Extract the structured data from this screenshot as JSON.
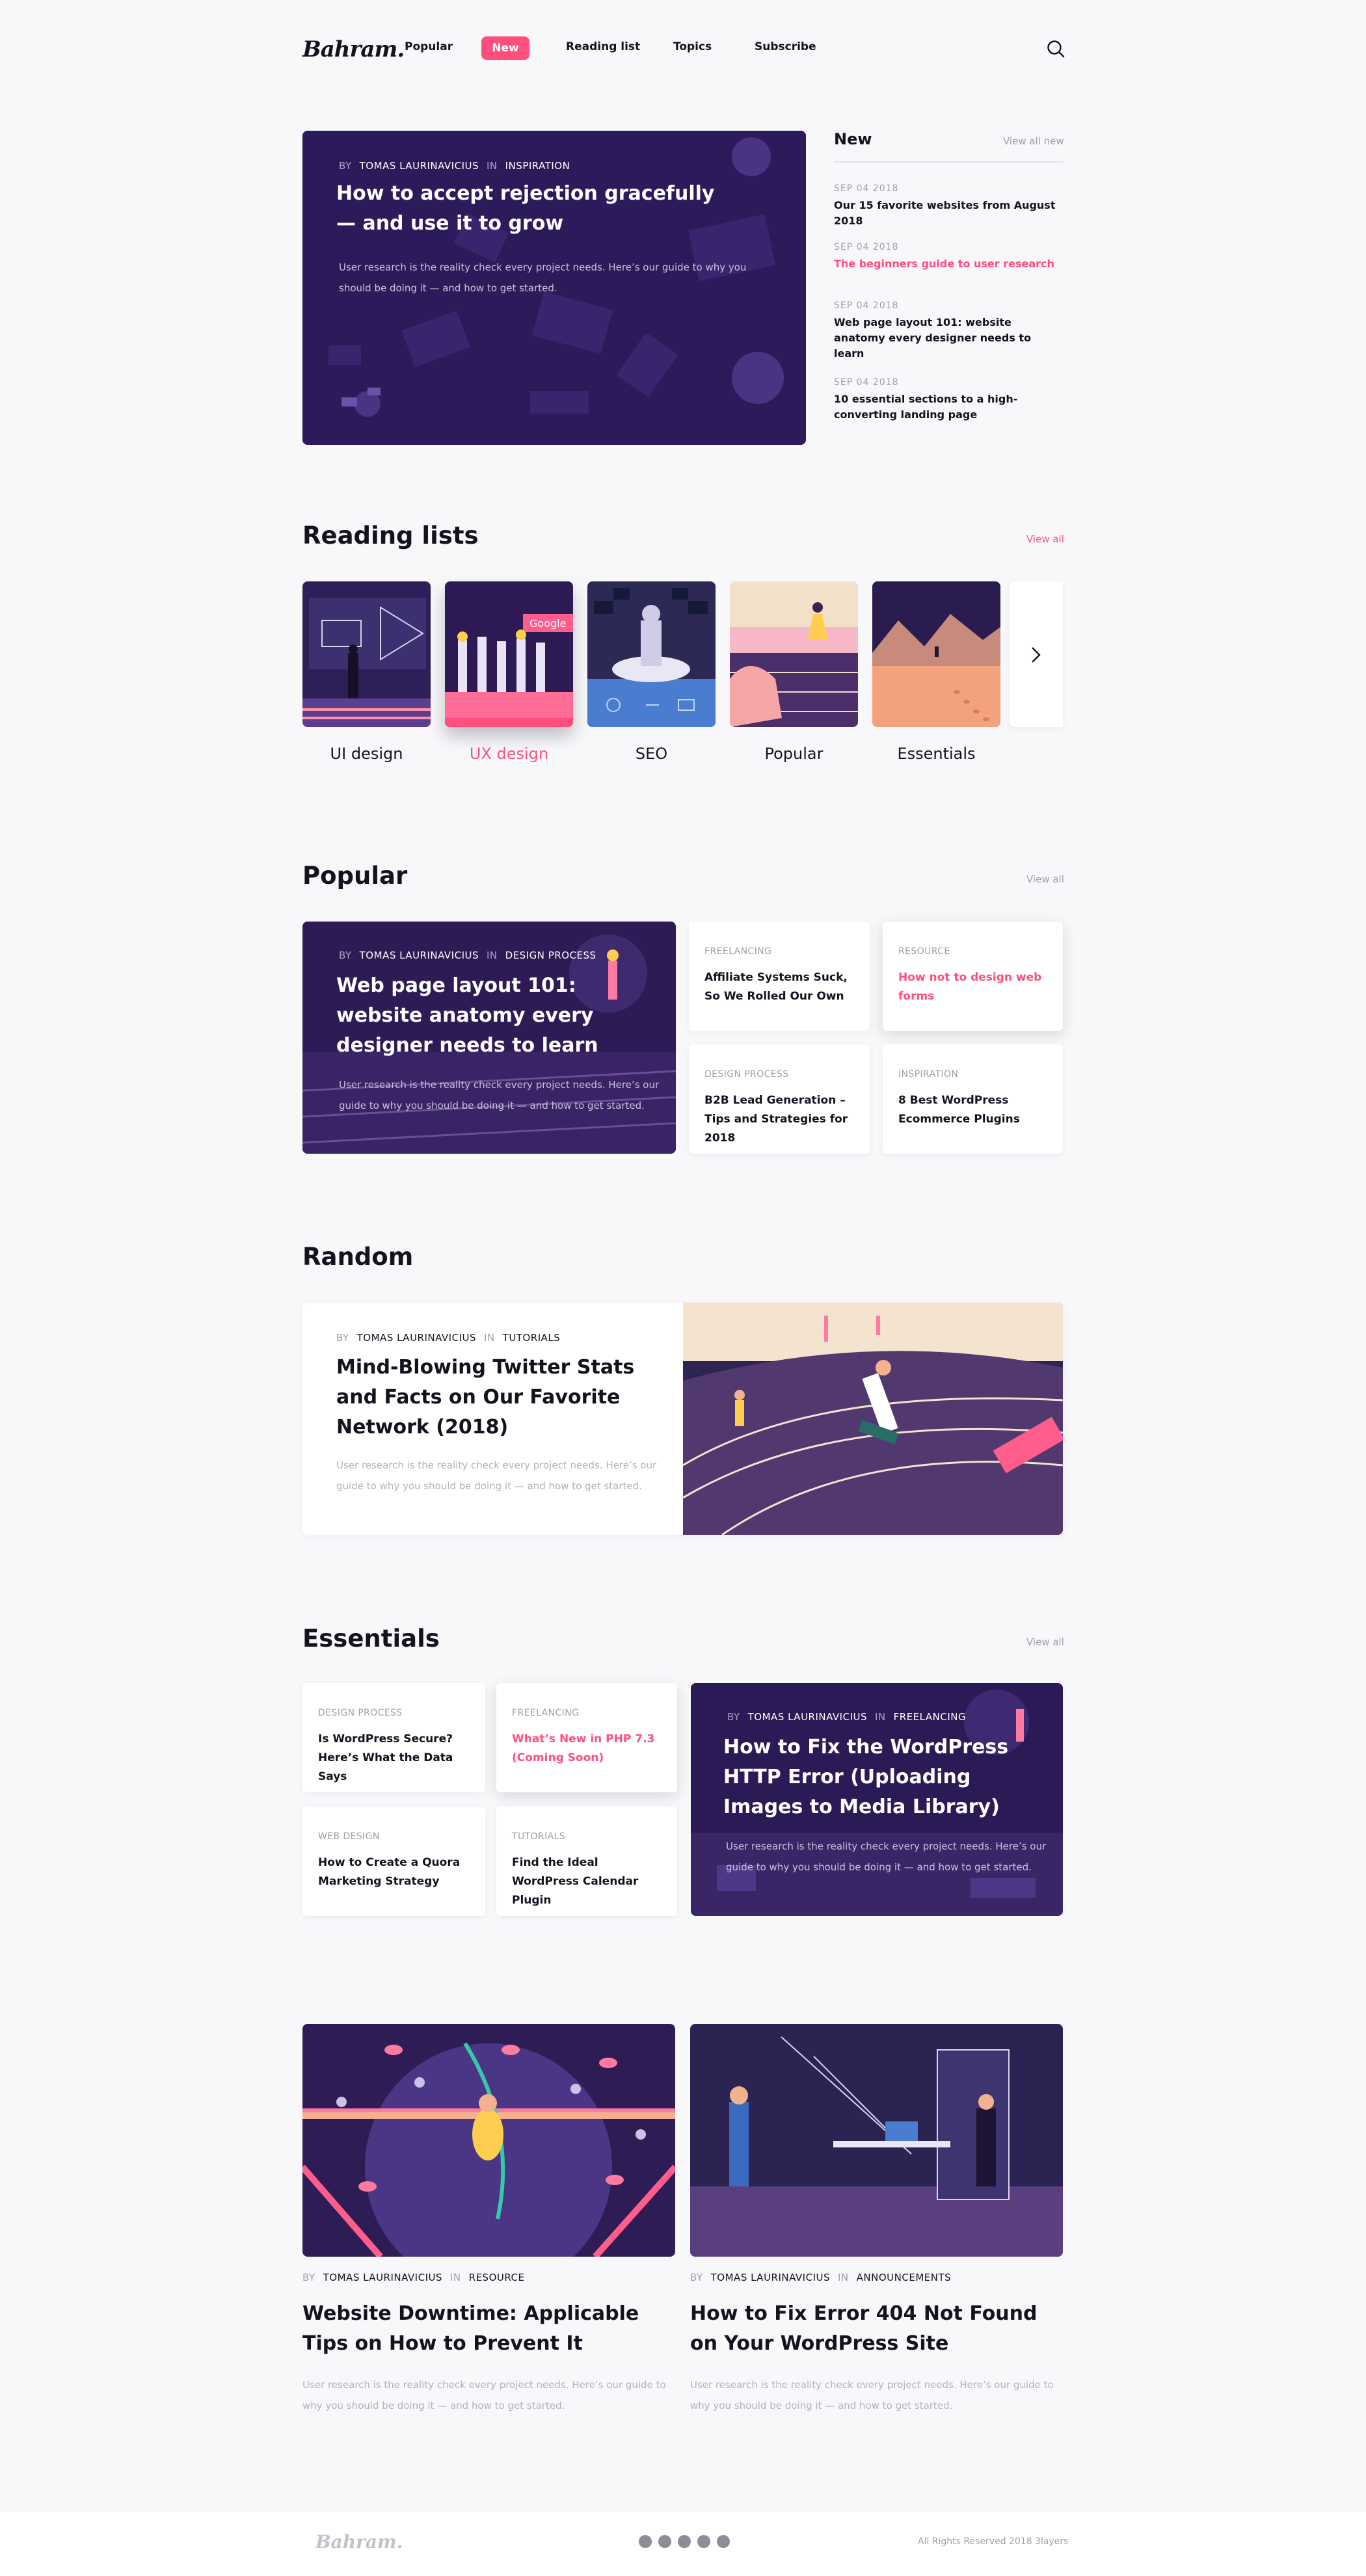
{
  "header": {
    "logo": "Bahram.",
    "nav": [
      {
        "label": "Popular"
      },
      {
        "label": "New"
      },
      {
        "label": "Reading list"
      },
      {
        "label": "Topics"
      },
      {
        "label": "Subscribe"
      }
    ],
    "search_icon": "search-icon",
    "accent": "#ff4f7e"
  },
  "hero": {
    "by_label": "BY",
    "author": "TOMAS LAURINAVICIUS",
    "in_label": "IN",
    "category": "INSPIRATION",
    "title": "How to accept rejection gracefully — and use it to grow",
    "description": "User research is the reality check every project needs. Here’s our guide to why you should be doing it — and how to get started."
  },
  "new_section": {
    "title": "New",
    "view_all": "View all new",
    "items": [
      {
        "date": "SEP  04  2018",
        "title": "Our 15 favorite websites from August 2018"
      },
      {
        "date": "SEP  04  2018",
        "title": "The beginners guide to user research"
      },
      {
        "date": "SEP  04  2018",
        "title": "Web page layout 101: website anatomy every designer needs to learn"
      },
      {
        "date": "SEP  04  2018",
        "title": "10 essential sections to a high-converting landing page"
      }
    ]
  },
  "reading_lists": {
    "title": "Reading lists",
    "view_all": "View all",
    "items": [
      {
        "label": "UI design"
      },
      {
        "label": "UX design"
      },
      {
        "label": "SEO"
      },
      {
        "label": "Popular"
      },
      {
        "label": "Essentials"
      }
    ],
    "next_icon": "chevron-right-icon"
  },
  "popular": {
    "title": "Popular",
    "view_all": "View all",
    "featured": {
      "by_label": "BY",
      "author": "TOMAS LAURINAVICIUS",
      "in_label": "IN",
      "category": "DESIGN PROCESS",
      "title": "Web page layout 101: website anatomy every designer needs to learn",
      "description": "User research is the reality check every project needs. Here’s our guide to why you should be doing it — and how to get started."
    },
    "cards": [
      {
        "category": "FREELANCING",
        "title": "Affiliate Systems Suck, So We Rolled Our Own"
      },
      {
        "category": "RESOURCE",
        "title": "How not to design web forms"
      },
      {
        "category": "DESIGN PROCESS",
        "title": "B2B Lead Generation – Tips and Strategies for 2018"
      },
      {
        "category": "INSPIRATION",
        "title": "8 Best WordPress Ecommerce Plugins"
      }
    ]
  },
  "random": {
    "title": "Random",
    "by_label": "BY",
    "author": "TOMAS LAURINAVICIUS",
    "in_label": "IN",
    "category": "TUTORIALS",
    "article_title": "Mind-Blowing Twitter Stats and Facts on Our Favorite Network (2018)",
    "description": "User research is the reality check every project needs. Here’s our guide to why you should be doing it — and how to get started."
  },
  "essentials": {
    "title": "Essentials",
    "view_all": "View all",
    "cards": [
      {
        "category": "DESIGN PROCESS",
        "title": "Is WordPress Secure? Here’s What the Data Says"
      },
      {
        "category": "FREELANCING",
        "title": "What’s New in PHP 7.3 (Coming Soon)"
      },
      {
        "category": "WEB DESIGN",
        "title": "How to Create a Quora Marketing Strategy"
      },
      {
        "category": "TUTORIALS",
        "title": "Find the Ideal WordPress Calendar Plugin"
      }
    ],
    "featured": {
      "by_label": "BY",
      "author": "TOMAS LAURINAVICIUS",
      "in_label": "IN",
      "category": "FREELANCING",
      "title": "How to Fix the WordPress HTTP Error (Uploading Images to Media Library)",
      "description": "User research is the reality check every project needs. Here’s our guide to why you should be doing it — and how to get started."
    }
  },
  "bottom_articles": [
    {
      "by_label": "BY",
      "author": "TOMAS LAURINAVICIUS",
      "in_label": "IN",
      "category": "RESOURCE",
      "title": "Website Downtime: Applicable Tips on How to Prevent It",
      "description": "User research is the reality check every project needs. Here’s our guide to why you should be doing it — and how to get started."
    },
    {
      "by_label": "BY",
      "author": "TOMAS LAURINAVICIUS",
      "in_label": "IN",
      "category": "ANNOUNCEMENTS",
      "title": "How to Fix Error 404 Not Found on Your WordPress Site",
      "description": "User research is the reality check every project needs. Here’s our guide to why you should be doing it — and how to get started."
    }
  ],
  "footer": {
    "logo": "Bahram.",
    "social_icons": [
      "medium-icon",
      "pinterest-icon",
      "instagram-icon",
      "twitter-icon",
      "facebook-icon"
    ],
    "copyright": "All Rights Reserved 2018 3layers"
  }
}
